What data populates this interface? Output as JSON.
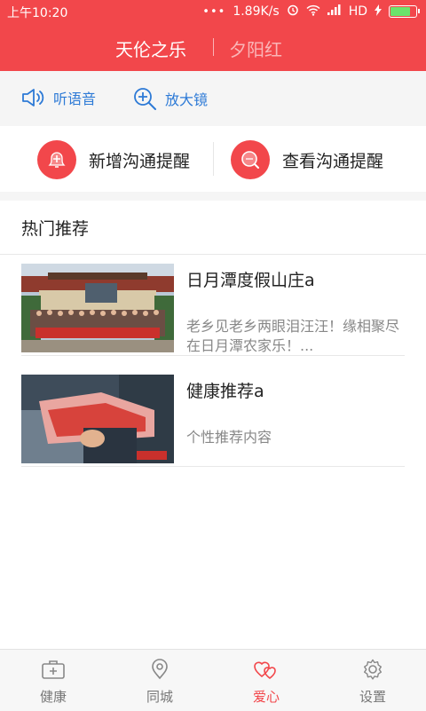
{
  "status_bar": {
    "time": "上午10:20",
    "speed": "1.89K/s",
    "network": "HD"
  },
  "header": {
    "title_active": "天伦之乐",
    "title_inactive": "夕阳红"
  },
  "toolbar": {
    "listen": "听语音",
    "magnifier": "放大镜"
  },
  "reminders": {
    "add": "新增沟通提醒",
    "view": "查看沟通提醒"
  },
  "recommend": {
    "heading": "热门推荐",
    "items": [
      {
        "title": "日月潭度假山庄a",
        "desc": "老乡见老乡两眼泪汪汪！缘相聚尽在日月潭农家乐！..."
      },
      {
        "title": "健康推荐a",
        "desc": "个性推荐内容"
      }
    ]
  },
  "tabs": [
    {
      "label": "健康",
      "icon": "medical-kit-icon"
    },
    {
      "label": "同城",
      "icon": "location-pin-icon"
    },
    {
      "label": "爱心",
      "icon": "hearts-icon"
    },
    {
      "label": "设置",
      "icon": "gear-icon"
    }
  ],
  "colors": {
    "brand": "#f2474b",
    "link": "#2d7ad6"
  }
}
